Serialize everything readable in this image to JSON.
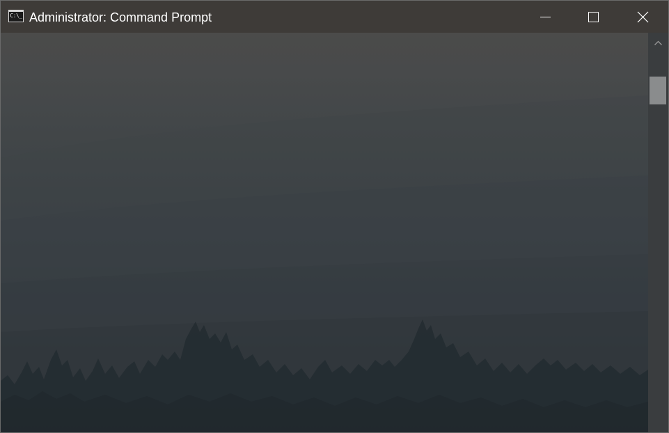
{
  "window": {
    "title": "Administrator: Command Prompt",
    "app_icon_text": "C:\\_",
    "icon": "command-prompt-icon"
  },
  "controls": {
    "minimize_icon": "minimize-icon",
    "maximize_icon": "maximize-icon",
    "close_icon": "close-icon"
  },
  "console": {
    "output_lines": []
  },
  "scrollbar": {
    "up_icon": "chevron-up-icon"
  },
  "colors": {
    "titlebar": "#3e3b38",
    "console_top": "#4b4b4a",
    "console_bottom": "#262d32",
    "scroll_thumb": "#8a8c8d"
  }
}
